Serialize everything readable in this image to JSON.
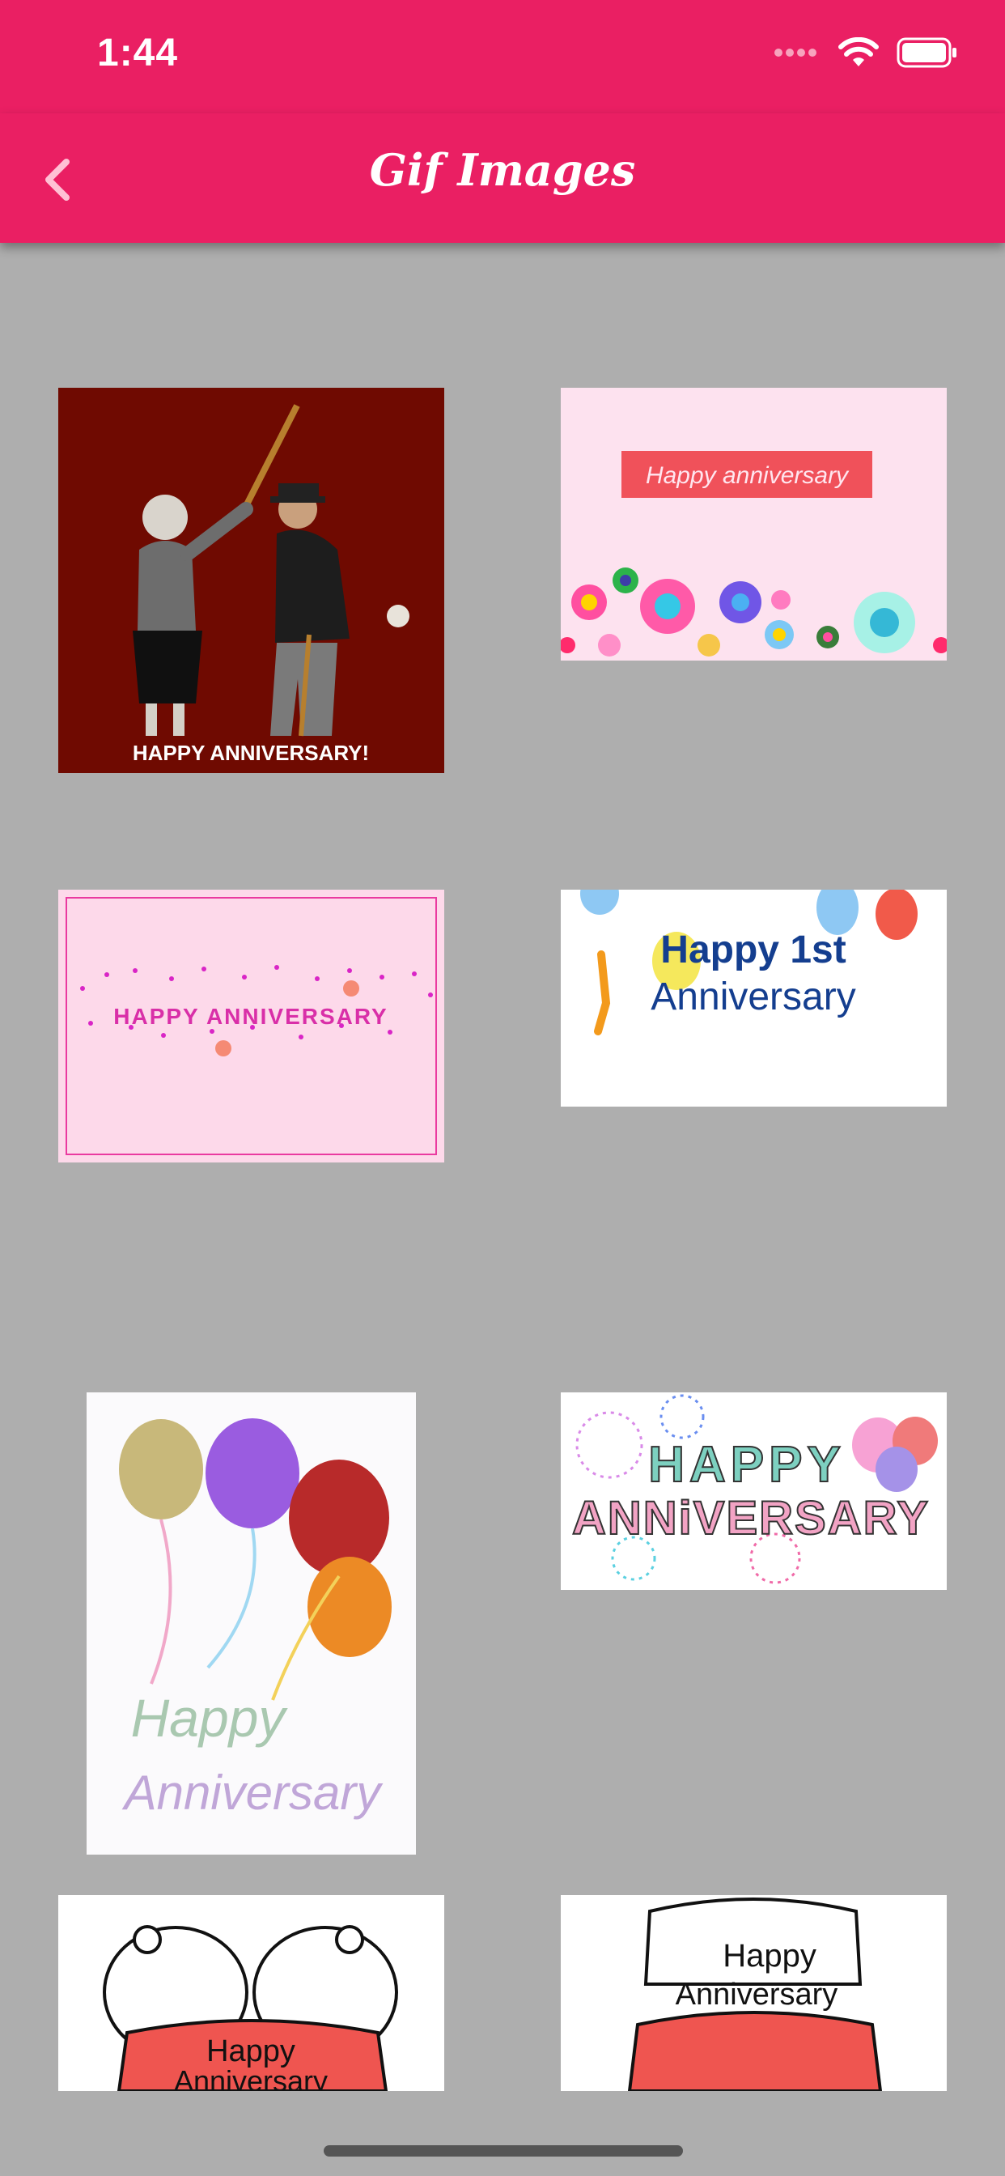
{
  "status_bar": {
    "time": "1:44",
    "wifi_icon": "wifi-icon",
    "battery_icon": "battery-icon",
    "signal_icon": "signal-dots-icon"
  },
  "nav": {
    "title": "Gif Images",
    "back_icon": "chevron-left-icon"
  },
  "colors": {
    "accent": "#ea1f63",
    "background": "#aeaeae"
  },
  "grid": [
    {
      "id": "gif-1",
      "caption": "HAPPY ANNIVERSARY!"
    },
    {
      "id": "gif-2",
      "caption": "Happy anniversary"
    },
    {
      "id": "gif-3",
      "caption": "HAPPY ANNIVERSARY"
    },
    {
      "id": "gif-4",
      "caption_line1": "Happy 1st",
      "caption_line2": "Anniversary"
    },
    {
      "id": "gif-5",
      "caption_line1": "Happy",
      "caption_line2": "Anniversary"
    },
    {
      "id": "gif-6",
      "caption_line1": "HAPPY",
      "caption_line2": "ANNiVERSARY"
    },
    {
      "id": "gif-7",
      "caption_line1": "Happy",
      "caption_line2": "Anniversary"
    },
    {
      "id": "gif-8",
      "caption_line1": "Happy",
      "caption_line2": "Anniversary"
    }
  ]
}
